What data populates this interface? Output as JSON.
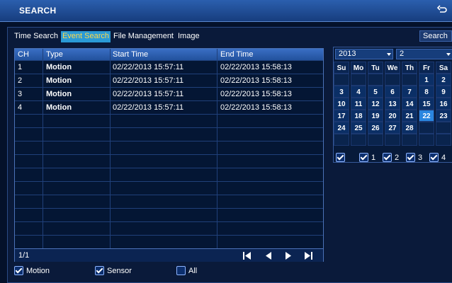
{
  "app": {
    "title": "SEARCH",
    "back_icon": "back-icon"
  },
  "tabs": [
    {
      "label": "Time Search"
    },
    {
      "label": "Event Search"
    },
    {
      "label": "File Management"
    },
    {
      "label": "Image"
    }
  ],
  "search_button": "Search",
  "table": {
    "headers": [
      "CH",
      "Type",
      "Start Time",
      "End Time"
    ],
    "rows": [
      [
        "1",
        "Motion",
        "02/22/2013 15:57:11",
        "02/22/2013 15:58:13"
      ],
      [
        "2",
        "Motion",
        "02/22/2013 15:57:11",
        "02/22/2013 15:58:13"
      ],
      [
        "3",
        "Motion",
        "02/22/2013 15:57:11",
        "02/22/2013 15:58:13"
      ],
      [
        "4",
        "Motion",
        "02/22/2013 15:57:11",
        "02/22/2013 15:58:13"
      ]
    ],
    "page": "1/1"
  },
  "filters": {
    "motion": {
      "label": "Motion",
      "checked": true
    },
    "sensor": {
      "label": "Sensor",
      "checked": true
    },
    "all": {
      "label": "All",
      "checked": false
    }
  },
  "calendar": {
    "year": "2013",
    "month": "2",
    "weekdays": [
      "Su",
      "Mo",
      "Tu",
      "We",
      "Th",
      "Fr",
      "Sa"
    ],
    "weeks": [
      [
        "",
        "",
        "",
        "",
        "",
        "1",
        "2"
      ],
      [
        "3",
        "4",
        "5",
        "6",
        "7",
        "8",
        "9"
      ],
      [
        "10",
        "11",
        "12",
        "13",
        "14",
        "15",
        "16"
      ],
      [
        "17",
        "18",
        "19",
        "20",
        "21",
        "22",
        "23"
      ],
      [
        "24",
        "25",
        "26",
        "27",
        "28",
        "",
        ""
      ],
      [
        "",
        "",
        "",
        "",
        "",
        "",
        ""
      ]
    ],
    "highlight": "22"
  },
  "channels": [
    {
      "label": "",
      "checked": true
    },
    {
      "label": "1",
      "checked": true
    },
    {
      "label": "2",
      "checked": true
    },
    {
      "label": "3",
      "checked": true
    },
    {
      "label": "4",
      "checked": true
    }
  ]
}
